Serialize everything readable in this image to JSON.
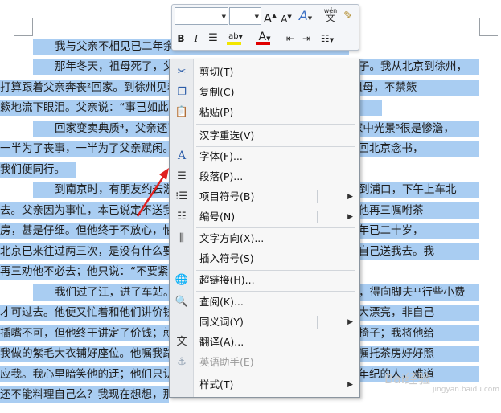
{
  "document": {
    "lines": [
      "　　我与父亲不相见已二年余了，我最不能忘记的是他的背影。",
      "　　那年冬天，祖母死了，父亲的差使也交卸了，正是祸不单行的日子。我从北京到徐州，",
      "打算跟着父亲奔丧²回家。到徐州见着父亲，看见满院狼藉的东西，又想起祖母，不禁簌",
      "簌地流下眼泪。父亲说：“事已如此，不必难过，好在天无绝人之路！”",
      "　　回家变卖典质⁴，父亲还了亏空；又借钱办了丧事。这些日子，家中光景⁵很是惨澹，",
      "一半为了丧事，一半为了父亲赋闲。丧事完毕，父亲要到南京谋事，我也要回北京念书，",
      "我们便同行。",
      "　　到南京时，有朋友约去游逛，勾留了一日；第二日上午便须渡江到浦口，下午上车北",
      "去。父亲因为事忙，本已说定不送我，叫旅馆里一个熟识的茶房陪我同去。他再三嘱咐茶",
      "房，甚是仔细。但他终于不放心，怕茶房不妥帖；颇踌躇了一会。其实我那年已二十岁，",
      "北京已来往过两三次，是没有什么要紧的了。他踌躇了一会，终于决定还是自己送我去。我",
      "再三劝他不必去；他只说：“不要紧，他们去不好！”",
      "　　我们过了江，进了车站。我买票，他忙着照看行李。行李太多了，得向脚夫¹¹行些小费",
      "才可过去。他便又忙着和他们讲价钱。我那时真是聪明过分，总觉他说话不大漂亮，非自己",
      "插嘴不可，但他终于讲定了价钱；就送我上车。他给我拣定了靠车门的一张椅子；我将他给",
      "我做的紫毛大衣铺好座位。他嘱我路上小心，夜里要警醒些，不要受凉。又嘱托茶房好好照",
      "应我。我心里暗笑他的迂；他们只认得钱，托他们直是白托！而且我这样大年纪的人，难道",
      "还不能料理自己么？我现在想想，那时真是太聪明了。"
    ]
  },
  "mini_toolbar": {
    "font_name": "",
    "font_size": "",
    "grow_font_label": "A",
    "shrink_font_label": "A",
    "text_effects_label": "A",
    "phonetic_label": "wén",
    "bold_label": "B",
    "italic_label": "I",
    "highlight_label": "ab",
    "font_color_label": "A",
    "icons": [
      "grow-font-icon",
      "shrink-font-icon",
      "text-effects-icon",
      "phonetic-guide-icon",
      "format-painter-icon",
      "center-align-icon",
      "decrease-indent-icon",
      "increase-indent-icon",
      "bullets-icon"
    ],
    "colors": {
      "highlight": "#f2e600",
      "font_color": "#e00000"
    }
  },
  "context_menu": {
    "items": [
      {
        "label": "剪切(T)",
        "icon": "scissors-icon"
      },
      {
        "label": "复制(C)",
        "icon": "copy-icon"
      },
      {
        "label": "粘贴(P)",
        "icon": "paste-icon"
      },
      {
        "label": "汉字重选(V)",
        "icon": ""
      },
      {
        "label": "字体(F)...",
        "icon": "font-icon"
      },
      {
        "label": "段落(P)...",
        "icon": "paragraph-icon"
      },
      {
        "label": "项目符号(B)",
        "icon": "bullets-icon"
      },
      {
        "label": "编号(N)",
        "icon": "numbering-icon"
      },
      {
        "label": "文字方向(X)...",
        "icon": "text-direction-icon"
      },
      {
        "label": "插入符号(S)",
        "icon": ""
      },
      {
        "label": "超链接(H)...",
        "icon": "hyperlink-icon"
      },
      {
        "label": "查阅(K)...",
        "icon": "research-icon"
      },
      {
        "label": "同义词(Y)",
        "icon": ""
      },
      {
        "label": "翻译(A)...",
        "icon": "translate-icon"
      },
      {
        "label": "英语助手(E)",
        "icon": "english-assistant-icon",
        "disabled": true
      },
      {
        "label": "样式(T)",
        "icon": ""
      }
    ]
  },
  "annotation": {
    "color": "#e02020"
  },
  "watermark": {
    "text": "Bai经验",
    "sub": "jingyan.baidu.com"
  }
}
